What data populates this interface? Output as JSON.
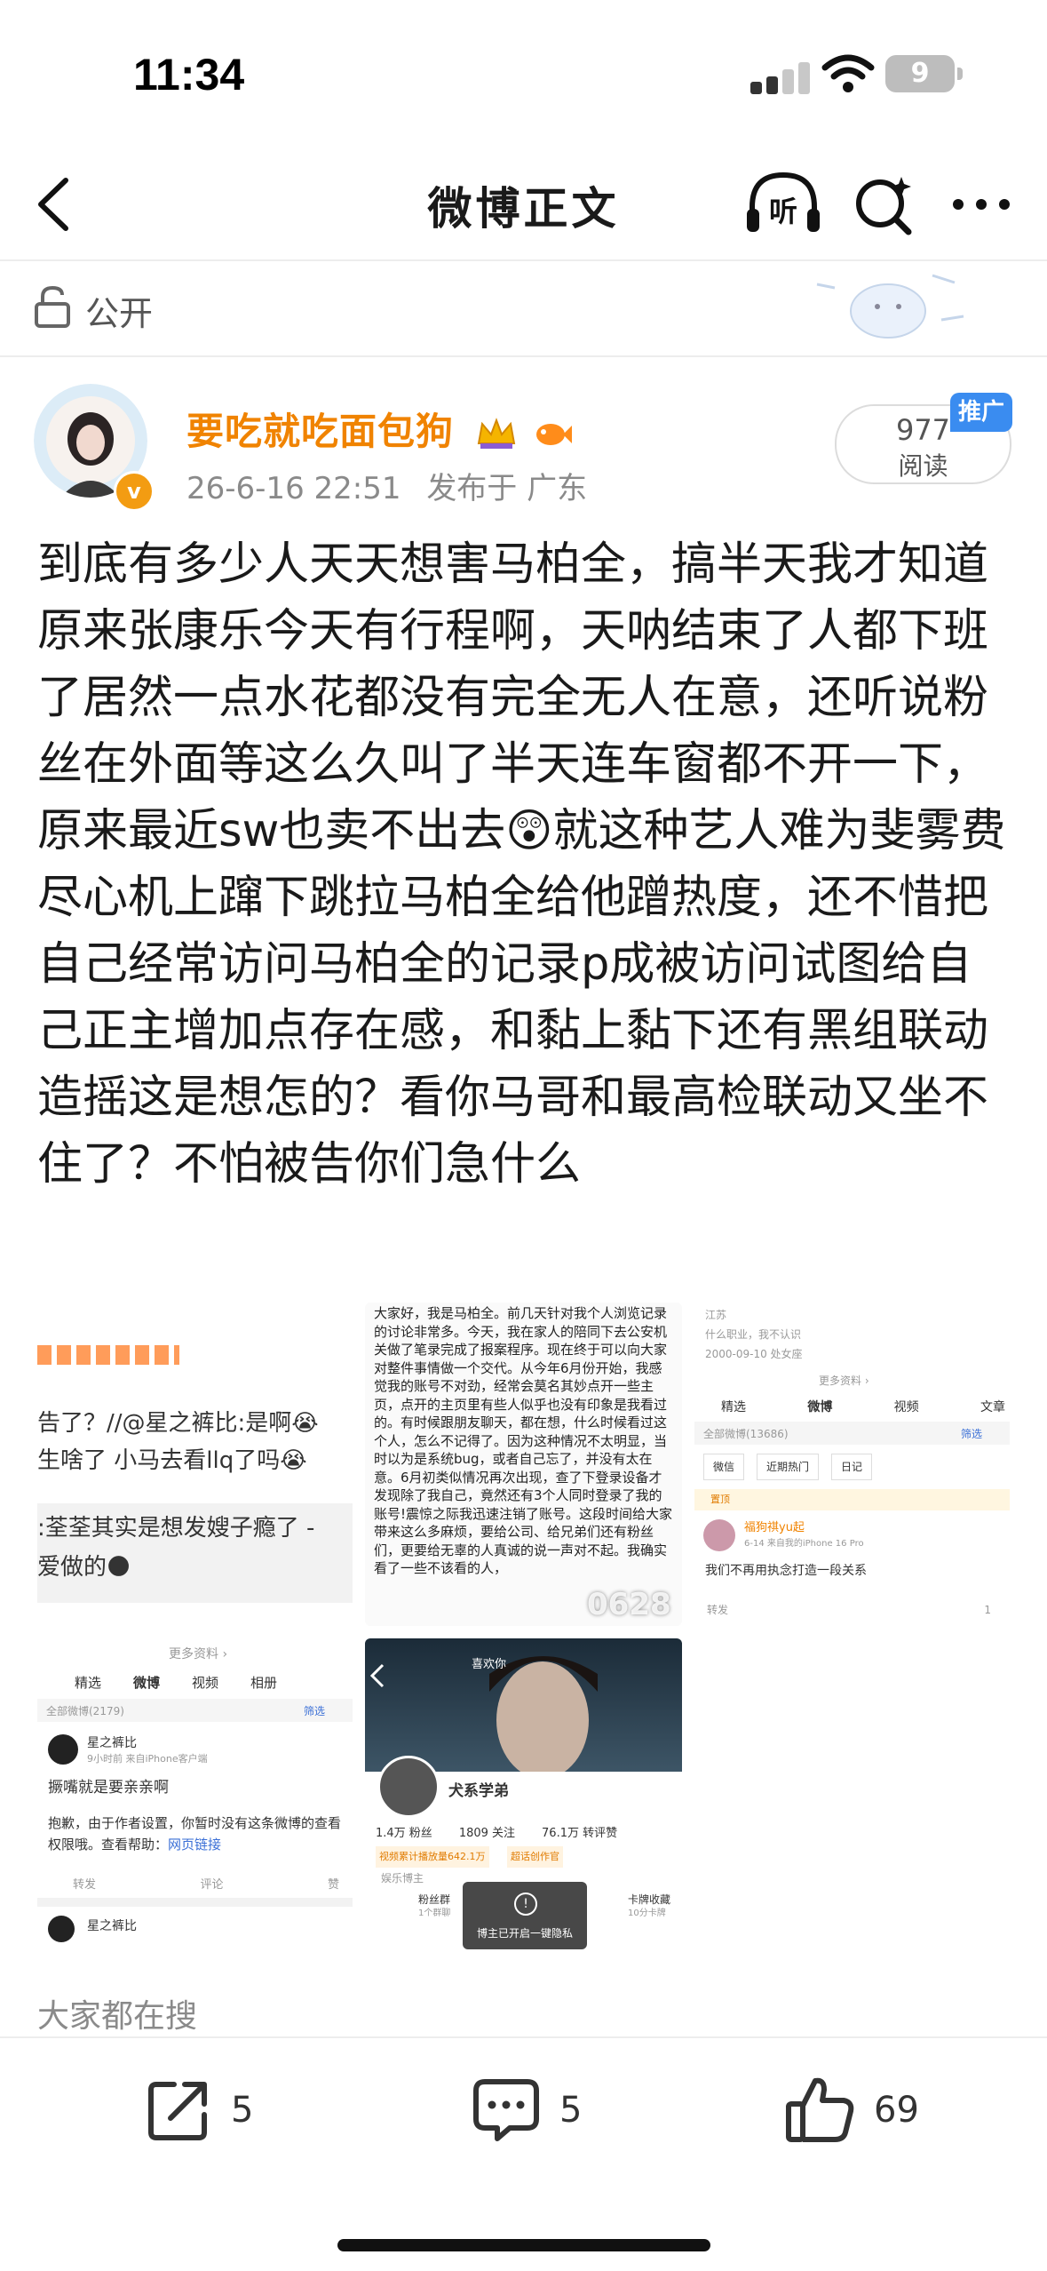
{
  "status": {
    "time": "11:34",
    "battery": "9"
  },
  "nav": {
    "title": "微博正文",
    "listen_label": "听"
  },
  "visibility": {
    "label": "公开"
  },
  "post": {
    "username": "要吃就吃面包狗",
    "time": "26-6-16 22:51",
    "location": "发布于 广东",
    "read_count": "977",
    "read_label": "阅读",
    "promo_label": "推广",
    "verified_badge": "v",
    "text": "到底有多少人天天想害马柏全，搞半天我才知道原来张康乐今天有行程啊，天呐结束了人都下班了居然一点水花都没有完全无人在意，还听说粉丝在外面等这么久叫了半天连车窗都不开一下，原来最近sw也卖不出去😲就这种艺人难为斐雾费尽心机上蹿下跳拉马柏全给他蹭热度，还不惜把自己经常访问马柏全的记录p成被访问试图给自己正主增加点存在感，和黏上黏下还有黑组联动造摇这是想怎的？看你马哥和最高检联动又坐不住了？不怕被告你们急什么"
  },
  "images": {
    "img1": {
      "line1": "告了？//@星之裤比:是啊😭",
      "line2": "生啥了 小马去看llq了吗😭",
      "line3": ":荃荃其实是想发嫂子瘾了 -",
      "line4": "爱做的🌑",
      "more": "更多资料 ›",
      "tabs": [
        "精选",
        "微博",
        "视频",
        "相册"
      ],
      "all_count": "全部微博(2179)",
      "filter": "筛选",
      "user": "星之裤比",
      "sub": "9小时前 来自iPhone客户端",
      "text1": "撅嘴就是要亲亲啊",
      "text2": "抱歉，由于作者设置，你暂时没有这条微博的查看权限哦。查看帮助：",
      "link": "网页链接",
      "actions": [
        "转发",
        "评论",
        "赞"
      ],
      "user2": "星之裤比"
    },
    "img2": {
      "text": "大家好，我是马柏全。前几天针对我个人浏览记录的讨论非常多。今天，我在家人的陪同下去公安机关做了笔录完成了报案程序。现在终于可以向大家对整件事情做一个交代。从今年6月份开始，我感觉我的账号不对劲，经常会莫名其妙点开一些主页，点开的主页里有些人似乎也没有印象是我看过的。有时候跟朋友聊天，都在想，什么时候看过这个人，怎么不记得了。因为这种情况不太明显，当时以为是系统bug，或者自己忘了，并没有太在意。6月初类似情况再次出现，查了下登录设备才发现除了我自己，竟然还有3个人同时登录了我的账号!震惊之际我迅速注销了账号。这段时间给大家带来这么多麻烦，要给公司、给兄弟们还有粉丝们，更要给无辜的人真诚的说一声对不起。我确实看了一些不该看的人，",
      "watermark": "0628"
    },
    "img3": {
      "like_label": "喜欢你",
      "name": "犬系学弟",
      "stats": [
        "1.4万 粉丝",
        "1809 关注",
        "76.1万 转评赞"
      ],
      "tag1": "视频累计播放量642.1万",
      "tag2": "超话创作官",
      "location": "娱乐博主",
      "fans_group": "粉丝群",
      "fans_sub": "1个群聊",
      "card": "卡牌收藏",
      "card_sub": "10分卡牌",
      "toast": "博主已开启一键隐私"
    },
    "img4": {
      "line1": "江苏",
      "line2": "什么职业，我不认识",
      "line3": "2000-09-10 处女座",
      "more": "更多资料 ›",
      "tabs": [
        "精选",
        "微博",
        "视频",
        "文章"
      ],
      "all_count": "全部微博(13686)",
      "filter": "筛选",
      "chips": [
        "微信",
        "近期热门",
        "日记"
      ],
      "pinned": "置顶",
      "user": "福狗祺yu起",
      "sub": "6-14 来自我的iPhone 16 Pro",
      "text": "我们不再用执念打造一段关系",
      "actions": [
        "转发",
        "1"
      ]
    }
  },
  "hot_search": {
    "label": "大家都在搜"
  },
  "actions": {
    "share_count": "5",
    "comment_count": "5",
    "like_count": "69"
  }
}
